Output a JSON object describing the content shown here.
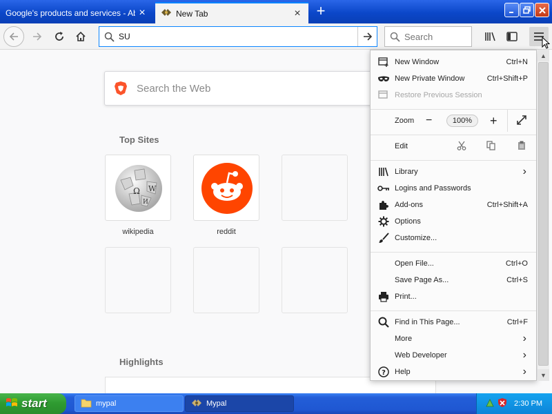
{
  "window": {
    "tabs": [
      {
        "title": "Google's products and services - About",
        "active": false
      },
      {
        "title": "New Tab",
        "active": true
      }
    ],
    "new_tab_symbol": "+"
  },
  "toolbar": {
    "url_value": "SU",
    "search_placeholder": "Search"
  },
  "newtab": {
    "web_search_placeholder": "Search the Web",
    "top_sites_title": "Top Sites",
    "highlights_title": "Highlights",
    "top_sites": [
      {
        "label": "wikipedia",
        "icon": "wikipedia-globe-icon"
      },
      {
        "label": "reddit",
        "icon": "reddit-alien-icon"
      }
    ]
  },
  "menu": {
    "window_items": [
      {
        "label": "New Window",
        "shortcut": "Ctrl+N",
        "icon": "new-window-icon"
      },
      {
        "label": "New Private Window",
        "shortcut": "Ctrl+Shift+P",
        "icon": "mask-icon"
      },
      {
        "label": "Restore Previous Session",
        "shortcut": "",
        "icon": "restore-session-icon",
        "disabled": true
      }
    ],
    "zoom_label": "Zoom",
    "zoom_value": "100%",
    "zoom_minus": "−",
    "zoom_plus": "+",
    "edit_label": "Edit",
    "items_group3": [
      {
        "label": "Library",
        "icon": "library-icon",
        "arrow": "›"
      },
      {
        "label": "Logins and Passwords",
        "icon": "key-icon"
      },
      {
        "label": "Add-ons",
        "shortcut": "Ctrl+Shift+A",
        "icon": "puzzle-icon"
      },
      {
        "label": "Options",
        "icon": "gear-icon"
      },
      {
        "label": "Customize...",
        "icon": "paintbrush-icon"
      }
    ],
    "items_group4": [
      {
        "label": "Open File...",
        "shortcut": "Ctrl+O"
      },
      {
        "label": "Save Page As...",
        "shortcut": "Ctrl+S"
      },
      {
        "label": "Print...",
        "icon": "printer-icon"
      }
    ],
    "items_group5": [
      {
        "label": "Find in This Page...",
        "shortcut": "Ctrl+F",
        "icon": "search-icon"
      },
      {
        "label": "More",
        "arrow": "›"
      },
      {
        "label": "Web Developer",
        "arrow": "›"
      },
      {
        "label": "Help",
        "arrow": "›",
        "icon": "help-icon"
      }
    ]
  },
  "taskbar": {
    "start_label": "start",
    "tasks": [
      {
        "label": "mypal",
        "icon": "folder-icon",
        "active": true
      },
      {
        "label": "Mypal",
        "icon": "mypal-app-icon",
        "active": false
      }
    ],
    "clock": "2:30 PM"
  },
  "colors": {
    "accent": "#0a84ff",
    "titlebar": "#0b47c9",
    "reddit": "#ff4500",
    "start_green": "#2e9a30"
  }
}
